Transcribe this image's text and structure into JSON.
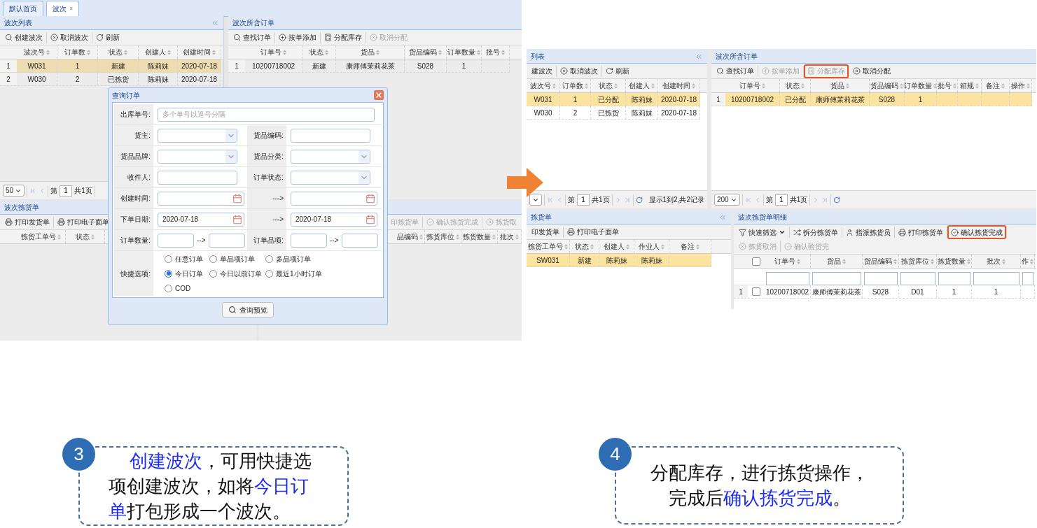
{
  "left_screen": {
    "tabs": [
      {
        "label": "默认首页",
        "selected": false,
        "closable": false
      },
      {
        "label": "波次",
        "selected": true,
        "closable": true
      }
    ],
    "close_glyph": "×",
    "wave_panel": {
      "title": "波次列表",
      "toolbar": [
        {
          "label": "创建波次",
          "kind": "search",
          "disabled": false
        },
        {
          "label": "取消波次",
          "kind": "cancel",
          "disabled": false
        },
        {
          "label": "刷新",
          "kind": "refresh",
          "disabled": false
        }
      ],
      "columns": [
        "波次号",
        "订单数",
        "状态",
        "创建人",
        "创建时间"
      ],
      "rows": [
        {
          "num": "1",
          "cells": [
            "W031",
            "1",
            "新建",
            "陈莉妹",
            "2020-07-18"
          ],
          "selected": true
        },
        {
          "num": "2",
          "cells": [
            "W030",
            "2",
            "已拣货",
            "陈莉妹",
            "2020-07-18"
          ],
          "selected": false
        }
      ],
      "pager": {
        "size": "50",
        "page_label": "第",
        "page": "1",
        "total": "共1页"
      }
    },
    "orders_panel": {
      "title": "波次所含订单",
      "toolbar": [
        {
          "label": "查找订单",
          "kind": "search",
          "disabled": false
        },
        {
          "label": "按单添加",
          "kind": "plus",
          "disabled": false
        },
        {
          "label": "分配库存",
          "kind": "calculator",
          "disabled": false
        },
        {
          "label": "取消分配",
          "kind": "cancel",
          "disabled": true
        }
      ],
      "columns": [
        "订单号",
        "状态",
        "货品",
        "货品编码",
        "订单数量",
        "批号"
      ],
      "rows": [
        {
          "num": "1",
          "cells": [
            "10200718002",
            "新建",
            "康师傅茉莉花茶",
            "S028",
            "1"
          ],
          "selected": false
        }
      ]
    },
    "pick_panel": {
      "title": "波次拣货单",
      "toolbar": [
        {
          "label": "打印发货单",
          "kind": "print",
          "disabled": false
        },
        {
          "label": "打印电子面单",
          "kind": "print",
          "disabled": false
        }
      ],
      "columns": [
        "拣货工单号",
        "状态"
      ]
    },
    "detail_panel": {
      "toolbar": [
        {
          "label": "印拣货单",
          "kind": "none",
          "disabled": true
        },
        {
          "label": "确认拣货完成",
          "kind": "check",
          "disabled": true
        },
        {
          "label": "拣货取",
          "kind": "cancel",
          "disabled": true
        }
      ],
      "columns": [
        "品编码",
        "拣货库位",
        "拣货数量",
        "批次"
      ]
    },
    "dialog": {
      "title": "查询订单",
      "rows": [
        {
          "kind": "full",
          "label": "出库单号:",
          "field": {
            "kind": "text",
            "placeholder": "多个单号以逗号分隔"
          }
        },
        {
          "kind": "pair",
          "items": [
            {
              "label": "货主:",
              "field": {
                "kind": "select"
              }
            },
            {
              "label": "货品编码:",
              "field": {
                "kind": "text"
              }
            }
          ]
        },
        {
          "kind": "pair",
          "items": [
            {
              "label": "货品品牌:",
              "field": {
                "kind": "select"
              }
            },
            {
              "label": "货品分类:",
              "field": {
                "kind": "select"
              }
            }
          ]
        },
        {
          "kind": "pair",
          "items": [
            {
              "label": "收件人:",
              "field": {
                "kind": "text"
              }
            },
            {
              "label": "订单状态:",
              "field": {
                "kind": "select"
              }
            }
          ]
        },
        {
          "kind": "pair",
          "items": [
            {
              "label": "创建时间:",
              "field": {
                "kind": "date"
              }
            },
            {
              "label": "--->",
              "field": {
                "kind": "date"
              }
            }
          ]
        },
        {
          "kind": "pair",
          "items": [
            {
              "label": "下单日期:",
              "field": {
                "kind": "date",
                "value": "2020-07-18"
              }
            },
            {
              "label": "--->",
              "field": {
                "kind": "date",
                "value": "2020-07-18"
              }
            }
          ]
        },
        {
          "kind": "pair",
          "items": [
            {
              "label": "订单数量:",
              "field": {
                "kind": "range",
                "separator": "-->"
              }
            },
            {
              "label": "订单品项:",
              "field": {
                "kind": "range",
                "separator": "-->"
              }
            }
          ]
        },
        {
          "kind": "radios",
          "label": "快捷选项:",
          "options": [
            {
              "label": "任意订单",
              "selected": false
            },
            {
              "label": "单品项订单",
              "selected": false
            },
            {
              "label": "多品项订单",
              "selected": false
            },
            {
              "label": "今日订单",
              "selected": true
            },
            {
              "label": "今日以前订单",
              "selected": false
            },
            {
              "label": "最近1小时订单",
              "selected": false
            },
            {
              "label": "COD",
              "selected": false
            }
          ]
        }
      ],
      "button": "查询预览"
    }
  },
  "right_screen": {
    "wave_panel": {
      "title": "列表",
      "toolbar": [
        {
          "label": "建波次",
          "kind": "none",
          "disabled": false
        },
        {
          "label": "取消波次",
          "kind": "cancel",
          "disabled": false
        },
        {
          "label": "刷新",
          "kind": "refresh",
          "disabled": false
        }
      ],
      "columns": [
        "波次号",
        "订单数",
        "状态",
        "创建人",
        "创建时间"
      ],
      "rows": [
        {
          "cells": [
            "W031",
            "1",
            "已分配",
            "陈莉妹",
            "2020-07-18"
          ],
          "selected": true
        },
        {
          "cells": [
            "W030",
            "2",
            "已拣货",
            "陈莉妹",
            "2020-07-18"
          ],
          "selected": false
        }
      ],
      "pager": {
        "page_label": "第",
        "page": "1",
        "total": "共1页",
        "info": "显示1到2,共2记录"
      }
    },
    "orders_panel": {
      "title": "波次所含订单",
      "toolbar": [
        {
          "label": "查找订单",
          "kind": "search",
          "disabled": false,
          "highlighted": false
        },
        {
          "label": "按单添加",
          "kind": "plus",
          "disabled": true,
          "highlighted": false
        },
        {
          "label": "分配库存",
          "kind": "calculator",
          "disabled": true,
          "highlighted": true
        },
        {
          "label": "取消分配",
          "kind": "cancel",
          "disabled": false,
          "highlighted": false
        }
      ],
      "columns": [
        "订单号",
        "状态",
        "货品",
        "货品编码",
        "订单数量",
        "批号",
        "箱规",
        "备注",
        "操作"
      ],
      "rows": [
        {
          "num": "1",
          "cells": [
            "10200718002",
            "已分配",
            "康师傅茉莉花茶",
            "S028",
            "1"
          ],
          "selected": true
        }
      ],
      "pager": {
        "size": "200",
        "page_label": "第",
        "page": "1",
        "total": "共1页"
      }
    },
    "pick_panel": {
      "title": "拣货单",
      "toolbar": [
        {
          "label": "印发货单",
          "kind": "none",
          "disabled": false
        },
        {
          "label": "打印电子面单",
          "kind": "print",
          "disabled": false
        }
      ],
      "columns": [
        "拣货工单号",
        "状态",
        "创建人",
        "作业人",
        "备注"
      ],
      "rows": [
        {
          "cells": [
            "SW031",
            "新建",
            "陈莉妹",
            "陈莉妹"
          ],
          "selected": true
        }
      ]
    },
    "detail_panel": {
      "title": "波次拣货单明细",
      "toolbar": [
        {
          "label": "快速筛选",
          "kind": "filter",
          "disabled": false,
          "highlighted": false,
          "dropdown": true
        },
        {
          "label": "拆分拣货单",
          "kind": "split",
          "disabled": false,
          "highlighted": false,
          "dropdown": false
        },
        {
          "label": "指派拣货员",
          "kind": "user",
          "disabled": false,
          "highlighted": false,
          "dropdown": false
        },
        {
          "label": "打印拣货单",
          "kind": "print",
          "disabled": false,
          "highlighted": false,
          "dropdown": false
        },
        {
          "label": "确认拣货完成",
          "kind": "check",
          "disabled": false,
          "highlighted": true,
          "dropdown": false
        },
        {
          "label": "拣货取消",
          "kind": "cancel",
          "disabled": true,
          "highlighted": false,
          "dropdown": false
        },
        {
          "label": "确认验货完",
          "kind": "check",
          "disabled": true,
          "highlighted": false,
          "dropdown": false
        }
      ],
      "header_checked": false,
      "columns": [
        "订单号",
        "货品",
        "货品编码",
        "拣货库位",
        "拣货数量",
        "批次",
        "作"
      ],
      "rows": [
        {
          "num": "1",
          "checked": false,
          "cells": [
            "10200718002",
            "康师傅茉莉花茶",
            "S028",
            "D01",
            "1",
            "1"
          ],
          "selected": false
        }
      ]
    }
  },
  "callouts": [
    {
      "number": "3",
      "segments": [
        {
          "text": "创建波次",
          "accent": true
        },
        {
          "text": "，可用快捷选项创建波次，如将",
          "accent": false
        },
        {
          "text": "今日订单",
          "accent": true
        },
        {
          "text": "打包形成一个波次。",
          "accent": false
        }
      ]
    },
    {
      "number": "4",
      "segments": [
        {
          "text": "分配库存，进行拣货操作，完成后",
          "accent": false
        },
        {
          "text": "确认拣货完成",
          "accent": true
        },
        {
          "text": "。",
          "accent": false
        }
      ]
    }
  ]
}
